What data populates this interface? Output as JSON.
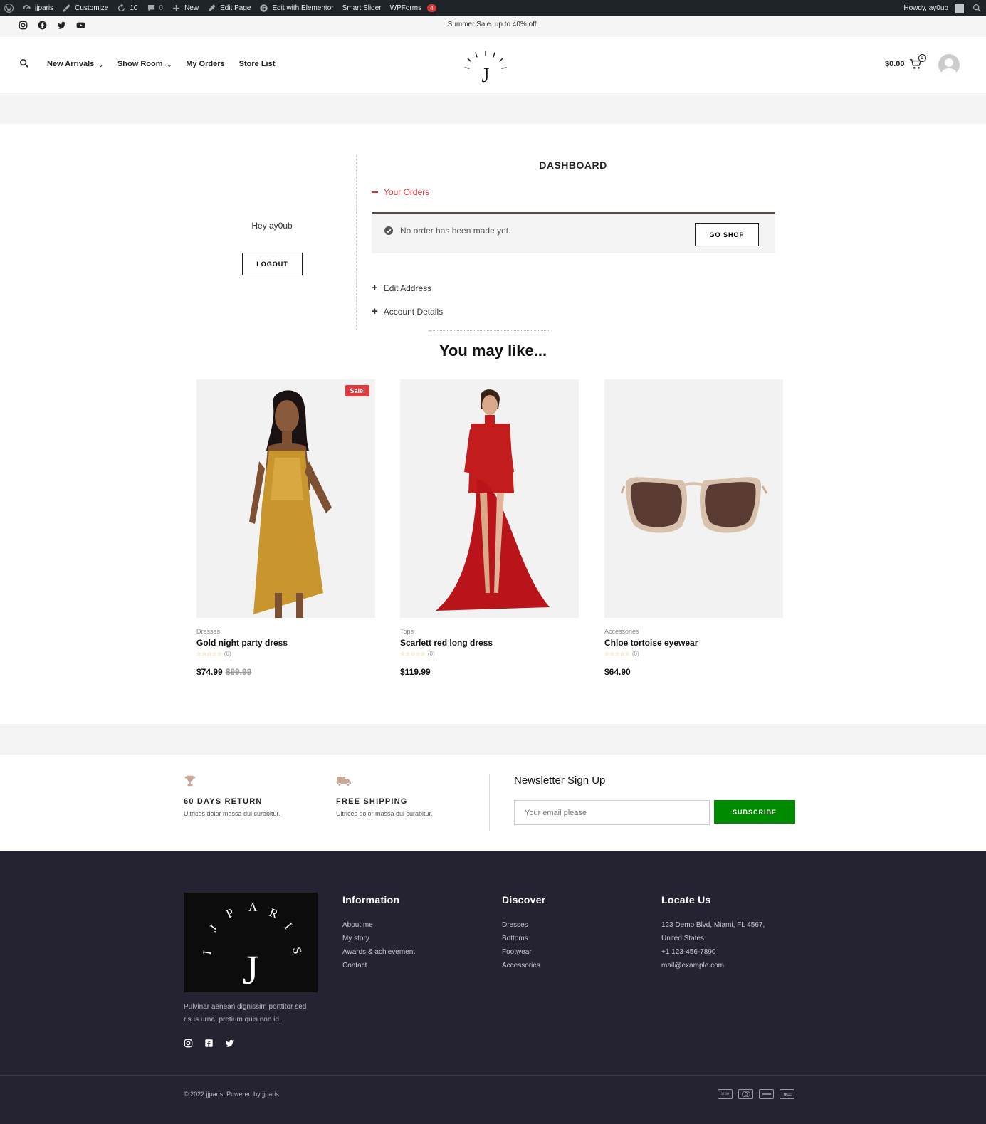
{
  "admin_bar": {
    "site": "jjparis",
    "customize": "Customize",
    "updates": "10",
    "comments": "0",
    "new": "New",
    "edit_page": "Edit Page",
    "elementor": "Edit with Elementor",
    "slider": "Smart Slider",
    "wpforms": "WPForms",
    "wpforms_badge": "4",
    "howdy": "Howdy, ay0ub"
  },
  "topbar": {
    "promo": "Summer Sale. up to 40% off."
  },
  "nav": {
    "items": [
      "New Arrivals",
      "Show Room",
      "My Orders",
      "Store List"
    ]
  },
  "cart": {
    "total": "$0.00",
    "count": "0"
  },
  "account": {
    "greeting": "Hey ay0ub",
    "logout": "LOGOUT",
    "title": "DASHBOARD",
    "orders_section": "Your Orders",
    "no_orders": "No order has been made yet.",
    "go_shop": "GO SHOP",
    "edit_address": "Edit Address",
    "account_details": "Account Details"
  },
  "related": {
    "title": "You may like...",
    "products": [
      {
        "category": "Dresses",
        "name": "Gold night party dress",
        "rating_count": "(0)",
        "price": "$74.99",
        "old_price": "$99.99",
        "badge": "Sale!"
      },
      {
        "category": "Tops",
        "name": "Scarlett red long dress",
        "rating_count": "(0)",
        "price": "$119.99"
      },
      {
        "category": "Accessories",
        "name": "Chloe tortoise eyewear",
        "rating_count": "(0)",
        "price": "$64.90"
      }
    ]
  },
  "features": [
    {
      "title": "60 DAYS RETURN",
      "text": "Ultrices dolor massa dui curabitur."
    },
    {
      "title": "FREE SHIPPING",
      "text": "Ultrices dolor massa dui curabitur."
    }
  ],
  "newsletter": {
    "title": "Newsletter Sign Up",
    "placeholder": "Your email please",
    "button": "SUBSCRIBE",
    "button_color": "#008a00"
  },
  "footer": {
    "description": "Pulvinar aenean dignissim porttitor sed risus urna, pretium quis non id.",
    "information": {
      "title": "Information",
      "links": [
        "About me",
        "My story",
        "Awards & achievement",
        "Contact"
      ]
    },
    "discover": {
      "title": "Discover",
      "links": [
        "Dresses",
        "Bottoms",
        "Footwear",
        "Accessories"
      ]
    },
    "locate": {
      "title": "Locate Us",
      "lines": [
        "123 Demo Blvd, Miami, FL 4567,",
        "United States",
        "+1 123-456-7890",
        "mail@example.com"
      ]
    },
    "copyright": "© 2022 jjparis. Powered by jjparis",
    "payments": [
      "visa-icon",
      "mastercard-icon",
      "amex-icon",
      "apple-pay-icon"
    ],
    "background": "#252231"
  },
  "colors": {
    "accent_red": "#d63638",
    "sale_red": "#e03a3e"
  }
}
